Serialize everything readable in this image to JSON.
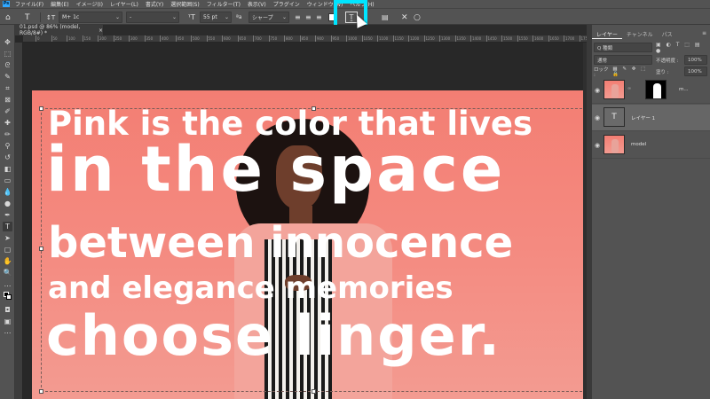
{
  "menubar": {
    "items": [
      "ファイル(F)",
      "編集(E)",
      "イメージ(I)",
      "レイヤー(L)",
      "書式(Y)",
      "選択範囲(S)",
      "フィルター(T)",
      "表示(V)",
      "プラグイン",
      "ウィンドウ(W)",
      "ヘルプ(H)"
    ]
  },
  "options": {
    "font_family": "M+ 1c",
    "font_style": "-",
    "font_size": "55 pt",
    "antialias": "シャープ"
  },
  "document": {
    "tab_label": "01.psd @ 86% (model, RGB/8#) *",
    "ruler_labels": [
      "0",
      "50",
      "100",
      "150",
      "200",
      "250",
      "300",
      "350",
      "400",
      "450",
      "500",
      "550",
      "600",
      "650",
      "700",
      "750",
      "800",
      "850",
      "900",
      "950",
      "1000",
      "1050",
      "1100",
      "1150",
      "1200",
      "1250",
      "1300",
      "1350",
      "1400",
      "1450",
      "1500",
      "1550",
      "1600",
      "1650",
      "1700",
      "1750"
    ]
  },
  "artwork": {
    "lines": [
      "Pink is the color that lives",
      "in the space",
      "between innocence",
      "and elegance memories",
      "choose linger."
    ]
  },
  "panel": {
    "tabs": [
      "レイヤー",
      "チャンネル",
      "パス"
    ],
    "search": "Q 種類",
    "blend_mode": "通常",
    "opacity_label": "不透明度 :",
    "opacity_value": "100%",
    "lock_label": "ロック :",
    "fill_label": "塗り :",
    "fill_value": "100%",
    "layers": [
      {
        "name": "m..."
      },
      {
        "name": "レイヤー 1"
      },
      {
        "name": "model"
      }
    ]
  },
  "colors": {
    "artboard_pink": "#f37e73",
    "highlight": "#00e5ff",
    "ps_blue": "#31a8ff"
  }
}
